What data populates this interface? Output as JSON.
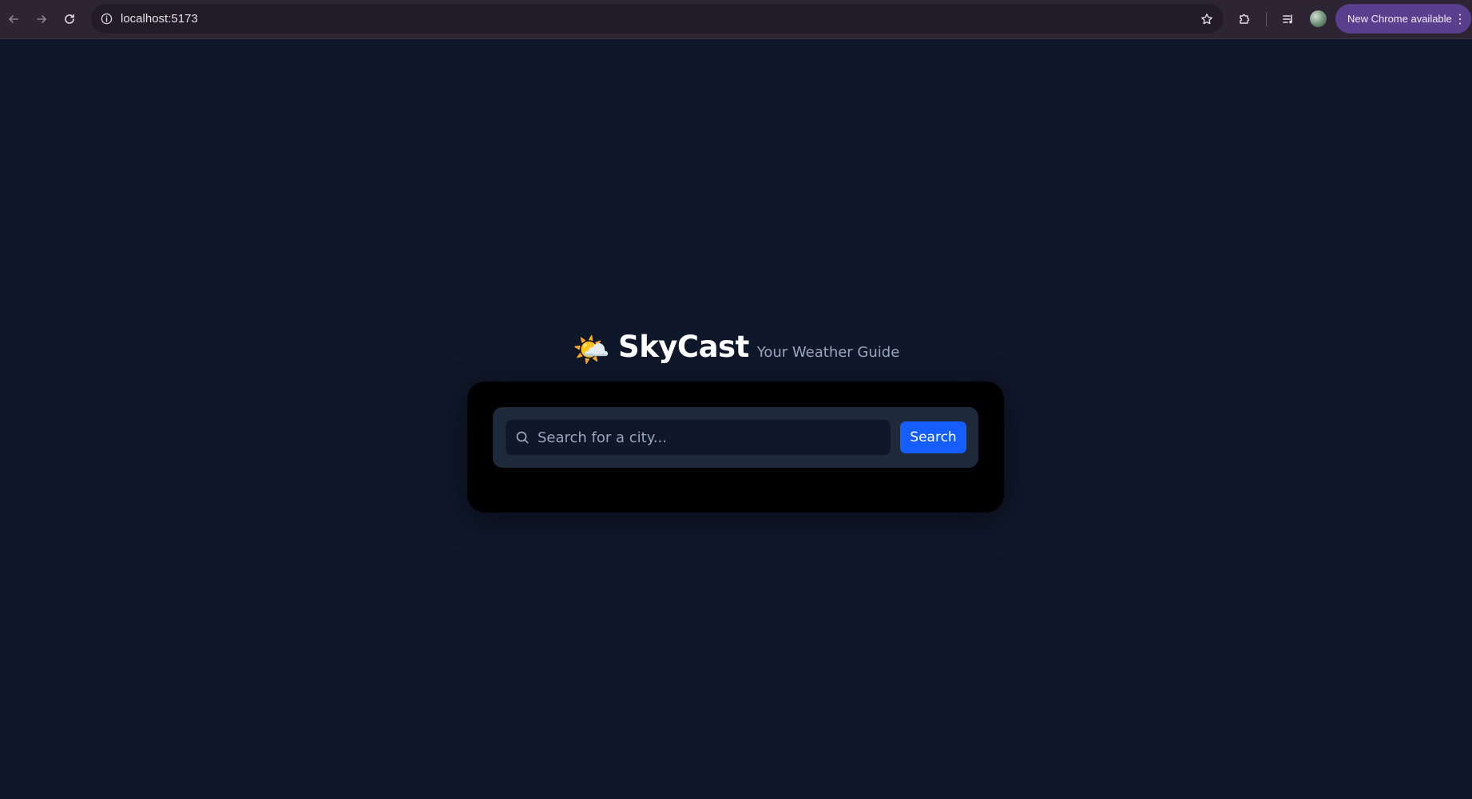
{
  "browser": {
    "url": "localhost:5173",
    "update_label": "New Chrome available",
    "icons": [
      "back-arrow-icon",
      "forward-arrow-icon",
      "reload-icon",
      "info-icon",
      "bookmark-star-icon",
      "extensions-icon",
      "media-controls-icon",
      "profile-avatar",
      "kebab-menu-icon"
    ],
    "update_color": "#5a3f8e"
  },
  "app": {
    "logo_emoji": "🌤️",
    "name": "SkyCast",
    "tagline": "Your Weather Guide",
    "background_color": "#0f172a",
    "accent_color": "#155dfc"
  },
  "search": {
    "placeholder": "Search for a city...",
    "value": "",
    "button_label": "Search"
  }
}
